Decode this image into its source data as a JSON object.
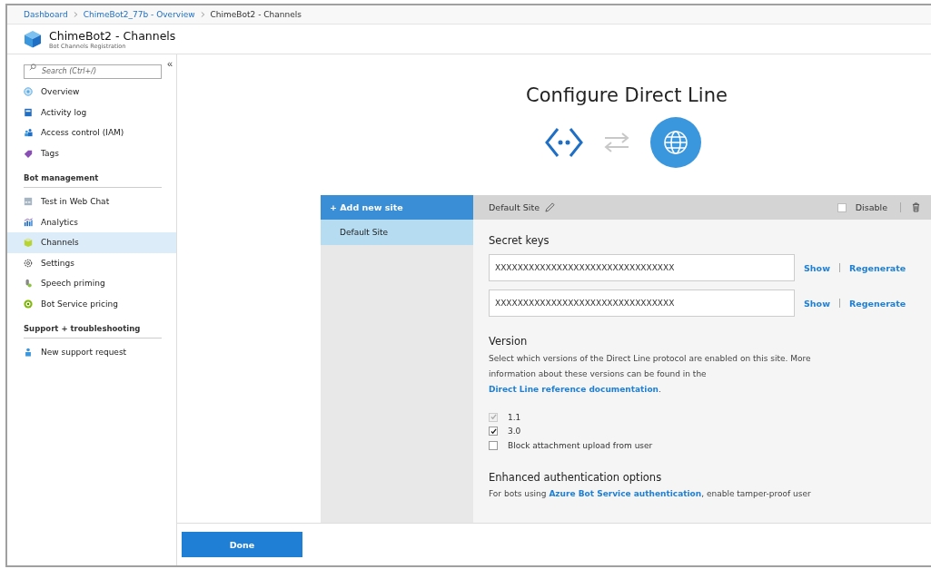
{
  "breadcrumb": [
    {
      "label": "Dashboard",
      "kind": "link"
    },
    {
      "label": "ChimeBot2_77b - Overview",
      "kind": "link"
    },
    {
      "label": "ChimeBot2 - Channels",
      "kind": "current"
    }
  ],
  "header": {
    "title": "ChimeBot2 - Channels",
    "subtitle": "Bot Channels Registration"
  },
  "sidebar": {
    "search": {
      "placeholder": "Search (Ctrl+/)"
    },
    "collapse": "«",
    "sections": [
      {
        "items": [
          {
            "label": "Overview",
            "selected": false
          },
          {
            "label": "Activity log",
            "selected": false
          },
          {
            "label": "Access control (IAM)",
            "selected": false
          },
          {
            "label": "Tags",
            "selected": false
          }
        ]
      },
      {
        "heading": "Bot management",
        "items": [
          {
            "label": "Test in Web Chat",
            "selected": false
          },
          {
            "label": "Analytics",
            "selected": false
          },
          {
            "label": "Channels",
            "selected": true
          },
          {
            "label": "Settings",
            "selected": false
          },
          {
            "label": "Speech priming",
            "selected": false
          },
          {
            "label": "Bot Service pricing",
            "selected": false
          }
        ]
      },
      {
        "heading": "Support + troubleshooting",
        "items": [
          {
            "label": "New support request",
            "selected": false
          }
        ]
      }
    ]
  },
  "main": {
    "title": "Configure Direct Line",
    "sites": {
      "add": "+ Add new site",
      "items": [
        {
          "label": "Default Site",
          "selected": true
        }
      ]
    },
    "site": {
      "name": "Default Site",
      "disable": {
        "label": "Disable",
        "checked": false
      },
      "keys_heading": "Secret keys",
      "keys": [
        {
          "value": "XXXXXXXXXXXXXXXXXXXXXXXXXXXXXXXX",
          "show": "Show",
          "regenerate": "Regenerate"
        },
        {
          "value": "XXXXXXXXXXXXXXXXXXXXXXXXXXXXXXXX",
          "show": "Show",
          "regenerate": "Regenerate"
        }
      ],
      "version": {
        "heading": "Version",
        "text": "Select which versions of the Direct Line protocol are enabled on this site. More information about these versions can be found in the ",
        "link": "Direct Line reference documentation",
        "after": ".",
        "options": [
          {
            "label": "1.1",
            "checked": true,
            "disabled": true
          },
          {
            "label": "3.0",
            "checked": true,
            "disabled": false
          },
          {
            "label": "Block attachment upload from user",
            "checked": false,
            "disabled": false
          }
        ]
      },
      "auth": {
        "heading": "Enhanced authentication options",
        "text": "For bots using ",
        "link": "Azure Bot Service authentication",
        "after": ", enable tamper-proof user"
      }
    }
  },
  "footer": {
    "done": "Done"
  }
}
